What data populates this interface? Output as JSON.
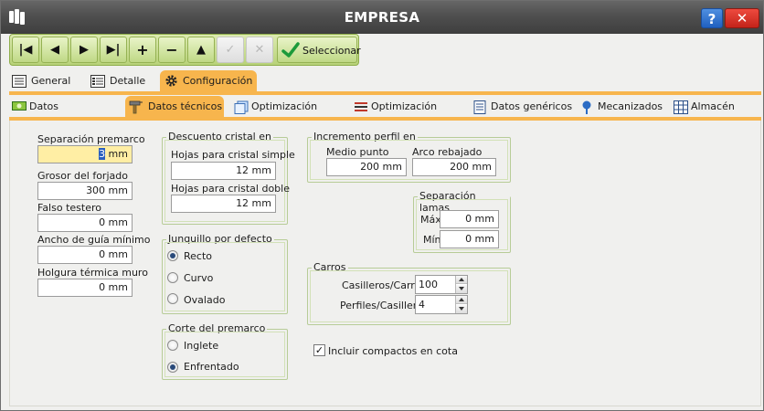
{
  "window": {
    "title": "EMPRESA",
    "help_label": "?",
    "close_label": "✕"
  },
  "toolbar": {
    "first_label": "|◀",
    "prev_label": "◀",
    "next_label": "▶",
    "last_label": "▶|",
    "add_label": "+",
    "remove_label": "−",
    "up_label": "▲",
    "confirm_label": "✓",
    "cancel_label": "✕",
    "select_label": "Seleccionar"
  },
  "main_tabs": [
    {
      "label": "General"
    },
    {
      "label": "Detalle"
    },
    {
      "label": "Configuración"
    }
  ],
  "sub_tabs": [
    {
      "label": "Datos económicos"
    },
    {
      "label": "Datos técnicos"
    },
    {
      "label": "Optimización plana"
    },
    {
      "label": "Optimización lineal"
    },
    {
      "label": "Datos genéricos"
    },
    {
      "label": "Mecanizados"
    },
    {
      "label": "Almacén"
    }
  ],
  "left_fields": {
    "separacion_premarco": {
      "label": "Separación premarco",
      "value_caret": "3",
      "value_rest": " mm"
    },
    "grosor_forjado": {
      "label": "Grosor del forjado",
      "value": "300 mm"
    },
    "falso_testero": {
      "label": "Falso testero",
      "value": "0 mm"
    },
    "ancho_guia": {
      "label": "Ancho de guía mínimo",
      "value": "0 mm"
    },
    "holgura_termica": {
      "label": "Holgura térmica muro",
      "value": "0 mm"
    }
  },
  "descuento_cristal": {
    "title": "Descuento cristal en",
    "simple_label": "Hojas para cristal simple",
    "simple_value": "12 mm",
    "doble_label": "Hojas para cristal doble",
    "doble_value": "12 mm"
  },
  "junquillo": {
    "title": "Junquillo por defecto",
    "options": [
      {
        "label": "Recto",
        "selected": true
      },
      {
        "label": "Curvo",
        "selected": false
      },
      {
        "label": "Ovalado",
        "selected": false
      }
    ]
  },
  "corte_premarco": {
    "title": "Corte del premarco",
    "options": [
      {
        "label": "Inglete",
        "selected": false
      },
      {
        "label": "Enfrentado",
        "selected": true
      }
    ]
  },
  "incremento_perfil": {
    "title": "Incremento perfil en",
    "medio_punto_label": "Medio punto",
    "medio_punto_value": "200 mm",
    "arco_rebajado_label": "Arco rebajado",
    "arco_rebajado_value": "200 mm"
  },
  "separacion_lamas": {
    "title": "Separación lamas",
    "max_label": "Máx",
    "max_value": "0 mm",
    "min_label": "Mín",
    "min_value": "0 mm"
  },
  "carros": {
    "title": "Carros",
    "casilleros_label": "Casilleros/Carro",
    "casilleros_value": "100",
    "perfiles_label": "Perfiles/Casillero",
    "perfiles_value": "4"
  },
  "incluir_compactos": {
    "label": "Incluir compactos en cota",
    "checked": true,
    "check_glyph": "✓"
  },
  "colors": {
    "titlebar": "#4f4f4f",
    "toolbar_green": "#b8d279",
    "tab_accent": "#f7b54d",
    "focused_field": "#ffeea4",
    "group_border": "#b7cc97"
  },
  "icons": {
    "app": "app-logo-icon",
    "general": "form-icon",
    "detalle": "list-detail-icon",
    "configuracion": "gear-icon",
    "datos_economicos": "money-icon",
    "datos_tecnicos": "tools-icon",
    "optimizacion_plana": "sheets-icon",
    "optimizacion_lineal": "bars-icon",
    "datos_genericos": "document-icon",
    "mecanizados": "pin-icon",
    "almacen": "grid-icon"
  }
}
